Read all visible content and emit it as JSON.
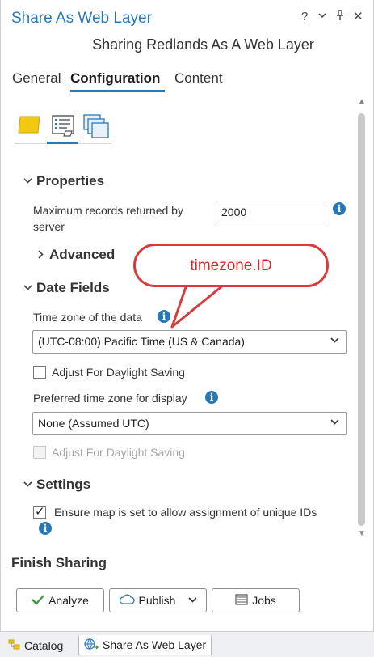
{
  "window": {
    "title": "Share As Web Layer",
    "subtitle": "Sharing Redlands As A Web Layer",
    "controls": {
      "help": "?",
      "menu": "⌄",
      "pin": "⊥",
      "close": "✕"
    }
  },
  "tabs": [
    {
      "label": "General",
      "active": false
    },
    {
      "label": "Configuration",
      "active": true
    },
    {
      "label": "Content",
      "active": false
    }
  ],
  "properties": {
    "header": "Properties",
    "max_records_label": "Maximum records returned by server",
    "max_records_value": "2000",
    "advanced_label": "Advanced"
  },
  "date_fields": {
    "header": "Date Fields",
    "tz_label": "Time zone of the data",
    "tz_value": "(UTC-08:00) Pacific Time (US & Canada)",
    "dst_label": "Adjust For Daylight Saving",
    "pref_label": "Preferred time zone for display",
    "pref_value": "None (Assumed UTC)",
    "pref_dst_label": "Adjust For Daylight Saving"
  },
  "settings": {
    "header": "Settings",
    "unique_ids_label": "Ensure map is set to allow assignment of unique IDs"
  },
  "callout": {
    "text": "timezone.ID",
    "color": "#d93a3a"
  },
  "footer": {
    "header": "Finish Sharing",
    "analyze": "Analyze",
    "publish": "Publish",
    "jobs": "Jobs"
  },
  "bottom_tabs": [
    {
      "label": "Catalog",
      "active": false
    },
    {
      "label": "Share As Web Layer",
      "active": true
    }
  ],
  "colors": {
    "accent": "#2a77b8",
    "callout": "#d93a3a"
  }
}
